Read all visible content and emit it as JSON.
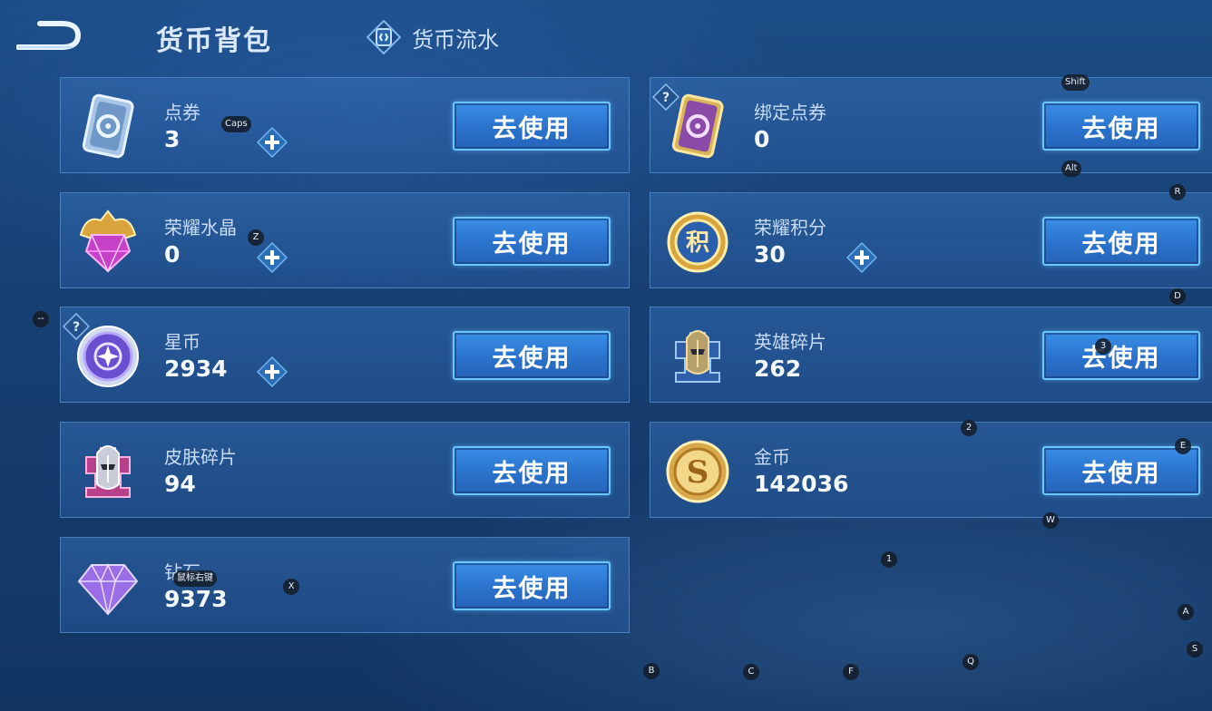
{
  "header": {
    "title": "货币背包",
    "flow_tab": "货币流水"
  },
  "cards": [
    {
      "name": "点券",
      "amount": "3",
      "icon": "coupon-card-icon",
      "has_plus": true,
      "has_help": false,
      "button": "去使用"
    },
    {
      "name": "绑定点券",
      "amount": "0",
      "icon": "bound-coupon-card-icon",
      "has_plus": false,
      "has_help": true,
      "button": "去使用"
    },
    {
      "name": "荣耀水晶",
      "amount": "0",
      "icon": "glory-crystal-icon",
      "has_plus": true,
      "has_help": false,
      "button": "去使用"
    },
    {
      "name": "荣耀积分",
      "amount": "30",
      "icon": "glory-points-icon",
      "has_plus": true,
      "has_help": false,
      "button": "去使用"
    },
    {
      "name": "星币",
      "amount": "2934",
      "icon": "star-coin-icon",
      "has_plus": true,
      "has_help": true,
      "button": "去使用"
    },
    {
      "name": "英雄碎片",
      "amount": "262",
      "icon": "hero-fragment-icon",
      "has_plus": false,
      "has_help": false,
      "button": "去使用"
    },
    {
      "name": "皮肤碎片",
      "amount": "94",
      "icon": "skin-fragment-icon",
      "has_plus": false,
      "has_help": false,
      "button": "去使用"
    },
    {
      "name": "金币",
      "amount": "142036",
      "icon": "gold-coin-icon",
      "has_plus": false,
      "has_help": false,
      "button": "去使用"
    },
    {
      "name": "钻石",
      "amount": "9373",
      "icon": "diamond-icon",
      "has_plus": false,
      "has_help": false,
      "button": "去使用"
    }
  ],
  "key_hints": [
    "Caps",
    "Shift",
    "Alt",
    "R",
    "Z",
    "D",
    "--",
    "3",
    "2",
    "E",
    "W",
    "1",
    "鼠标右键",
    "X",
    "A",
    "S",
    "B",
    "C",
    "F",
    "Q"
  ],
  "colors": {
    "background": "#173f72",
    "button": "#2a72cc",
    "button_border": "#6cc6ff",
    "card_border": "#78b4f0"
  }
}
